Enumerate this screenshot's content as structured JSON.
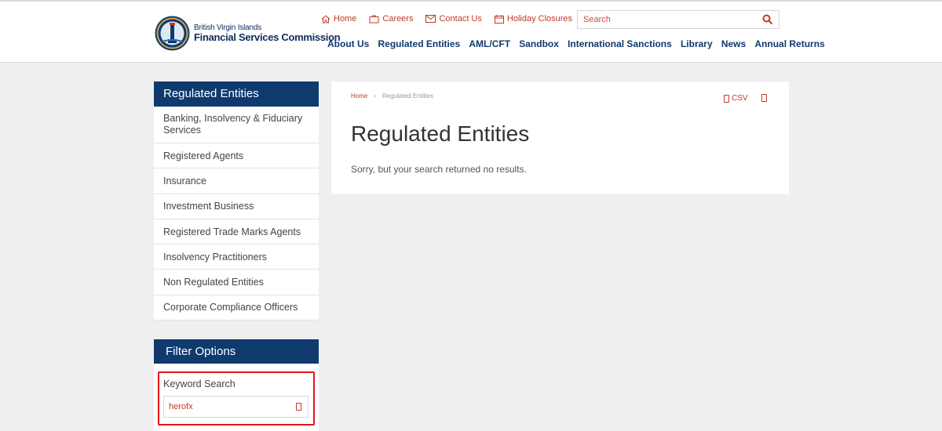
{
  "logo": {
    "line1": "British Virgin Islands",
    "line2": "Financial Services Commission"
  },
  "util_links": [
    {
      "label": "Home",
      "icon": "home-icon"
    },
    {
      "label": "Careers",
      "icon": "careers-icon"
    },
    {
      "label": "Contact Us",
      "icon": "envelope-icon"
    },
    {
      "label": "Holiday Closures",
      "icon": "calendar-icon"
    }
  ],
  "search": {
    "placeholder": "Search",
    "value": ""
  },
  "main_nav": [
    "About Us",
    "Regulated Entities",
    "AML/CFT",
    "Sandbox",
    "International Sanctions",
    "Library",
    "News",
    "Annual Returns"
  ],
  "sidebar": {
    "title": "Regulated Entities",
    "items": [
      "Banking, Insolvency & Fiduciary Services",
      "Registered Agents",
      "Insurance",
      "Investment Business",
      "Registered Trade Marks Agents",
      "Insolvency Practitioners",
      "Non Regulated Entities",
      "Corporate Compliance Officers"
    ]
  },
  "filter": {
    "title": "Filter Options",
    "keyword_label": "Keyword Search",
    "keyword_value": "herofx"
  },
  "content": {
    "breadcrumb_home": "Home",
    "breadcrumb_sep": "›",
    "breadcrumb_current": "Regulated Entities",
    "title": "Regulated Entities",
    "message": "Sorry, but your search returned no results.",
    "csv_label": "CSV"
  },
  "colors": {
    "navy": "#0f3a6e",
    "accent_red": "#c0392b",
    "highlight": "#e3141b",
    "page_bg": "#efefef"
  }
}
